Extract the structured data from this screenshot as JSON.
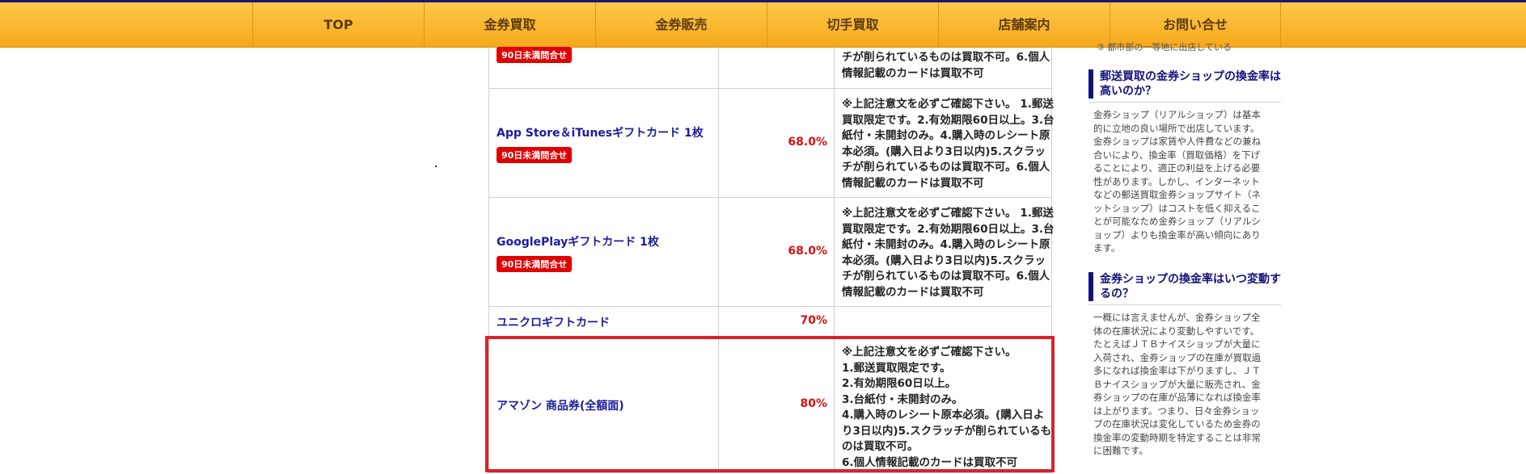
{
  "nav": {
    "items": [
      "TOP",
      "金券買取",
      "金券販売",
      "切手買取",
      "店舗案内",
      "お問い合せ"
    ]
  },
  "table": {
    "rows": [
      {
        "name": "",
        "badge": "90日未満問合せ",
        "rate": "",
        "note_lines": [
          "チが削られているものは買取不可。6.個人",
          "情報記載のカードは買取不可"
        ]
      },
      {
        "name": "App Store＆iTunesギフトカード 1枚",
        "badge": "90日未満問合せ",
        "rate": "68.0%",
        "note_lines": [
          "※上記注意文を必ずご確認下さい。 1.郵送",
          "買取限定です。2.有効期限60日以上。3.台",
          "紙付・未開封のみ。4.購入時のレシート原",
          "本必須。(購入日より3日以内)5.スクラッ",
          "チが削られているものは買取不可。6.個人",
          "情報記載のカードは買取不可"
        ]
      },
      {
        "name": "GooglePlayギフトカード 1枚",
        "badge": "90日未満問合せ",
        "rate": "68.0%",
        "note_lines": [
          "※上記注意文を必ずご確認下さい。 1.郵送",
          "買取限定です。2.有効期限60日以上。3.台",
          "紙付・未開封のみ。4.購入時のレシート原",
          "本必須。(購入日より3日以内)5.スクラッ",
          "チが削られているものは買取不可。6.個人",
          "情報記載のカードは買取不可"
        ]
      },
      {
        "name": "ユニクロギフトカード",
        "badge": "",
        "rate": "70%",
        "note_lines": []
      },
      {
        "name": "アマゾン 商品券(全額面)",
        "badge": "",
        "rate": "80%",
        "note_lines": [
          "※上記注意文を必ずご確認下さい。",
          "1.郵送買取限定です。",
          "2.有効期限60日以上。",
          "3.台紙付・未開封のみ。",
          "4.購入時のレシート原本必須。(購入日よ",
          "り3日以内)5.スクラッチが削られているも",
          "のは買取不可。",
          "6.個人情報記載のカードは買取不可"
        ]
      }
    ]
  },
  "sidebar": {
    "cut_text": "③ 都市部の一等地に出店している",
    "sections": [
      {
        "title_lines": [
          "郵送買取の金券ショップの換金率は",
          "高いのか？"
        ],
        "body_lines": [
          "金券ショップ（リアルショップ）は基本",
          "的に立地の良い場所で出店しています。",
          "金券ショップは家賃や人件費などの兼ね",
          "合いにより、換金率（買取価格）を下げ",
          "ることにより、適正の利益を上げる必要",
          "性があります。しかし、インターネット",
          "などの郵送買取金券ショップサイト（ネ",
          "ットショップ）はコストを低く抑えるこ",
          "とが可能なため金券ショップ（リアルシ",
          "ョップ）よりも換金率が高い傾向にあり",
          "ます。"
        ]
      },
      {
        "title_lines": [
          "金券ショップの換金率はいつ変動す",
          "るの？"
        ],
        "body_lines": [
          "一概には言えませんが、金券ショップ全",
          "体の在庫状況により変動しやすいです。",
          "たとえばＪＴＢナイスショップが大量に",
          "入荷され、金券ショップの在庫が買取過",
          "多になれば換金率は下がりますし、ＪＴ",
          "Ｂナイスショップが大量に販売され、金",
          "券ショップの在庫が品薄になれば換金率",
          "は上がります。つまり、日々金券ショッ",
          "プの在庫状況は変化しているため金券の",
          "換金率の変動時期を特定することは非常",
          "に困難です。"
        ]
      }
    ]
  }
}
